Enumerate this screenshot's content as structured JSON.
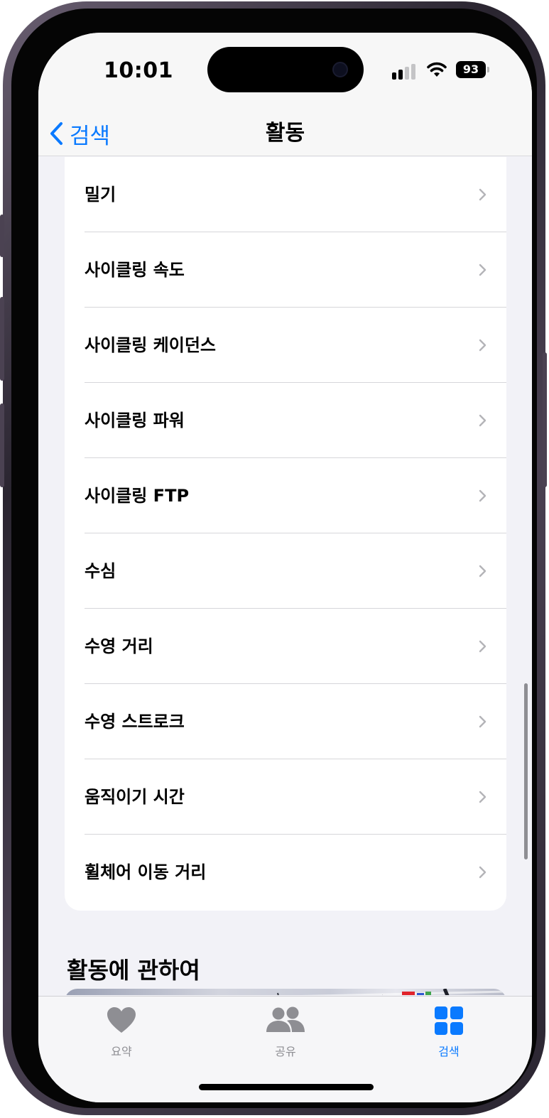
{
  "status_bar": {
    "time": "10:01",
    "battery": "93"
  },
  "nav": {
    "back_label": "검색",
    "title": "활동"
  },
  "list_items": [
    "밀기",
    "사이클링 속도",
    "사이클링 케이던스",
    "사이클링 파워",
    "사이클링 FTP",
    "수심",
    "수영 거리",
    "수영 스트로크",
    "움직이기 시간",
    "휠체어 이동 거리"
  ],
  "section": {
    "title": "활동에 관하여"
  },
  "tabs": [
    {
      "label": "요약",
      "icon": "heart-icon",
      "active": false
    },
    {
      "label": "공유",
      "icon": "people-icon",
      "active": false
    },
    {
      "label": "검색",
      "icon": "grid-icon",
      "active": true
    }
  ],
  "colors": {
    "accent": "#0a7aff",
    "inactive": "#8e8e93",
    "background": "#f2f2f7"
  }
}
